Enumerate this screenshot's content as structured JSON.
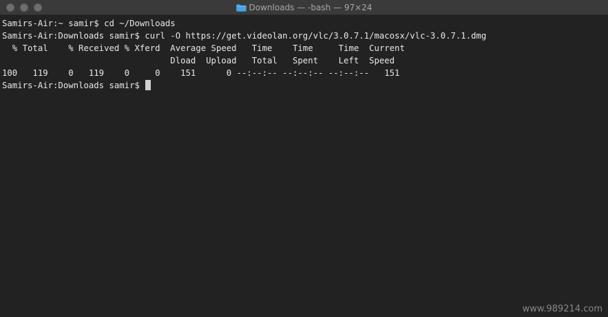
{
  "window": {
    "title": "Downloads — -bash — 97×24",
    "folder_icon": "folder-icon",
    "colors": {
      "background": "#222222",
      "text": "#e8e8e8",
      "titlebar": "#3a3a3a",
      "folder": "#4aa3df"
    }
  },
  "terminal": {
    "lines": [
      "Samirs-Air:~ samir$ cd ~/Downloads",
      "Samirs-Air:Downloads samir$ curl -O https://get.videolan.org/vlc/3.0.7.1/macosx/vlc-3.0.7.1.dmg",
      "  % Total    % Received % Xferd  Average Speed   Time    Time     Time  Current",
      "                                 Dload  Upload   Total   Spent    Left  Speed",
      "100   119    0   119    0     0    151      0 --:--:-- --:--:-- --:--:--   151",
      "Samirs-Air:Downloads samir$ "
    ]
  },
  "watermark": "www.989214.com"
}
